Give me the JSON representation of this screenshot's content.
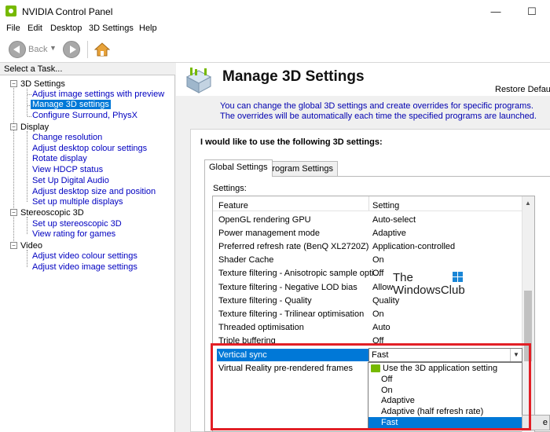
{
  "window": {
    "title": "NVIDIA Control Panel",
    "minimize": "—",
    "maximize": "☐",
    "close": "✕"
  },
  "menu": [
    "File",
    "Edit",
    "Desktop",
    "3D Settings",
    "Help"
  ],
  "toolbar": {
    "back": "Back",
    "back_arrow": "▼"
  },
  "left_panel": {
    "header": "Select a Task...",
    "tree": [
      {
        "category": "3D Settings",
        "items": [
          "Adjust image settings with preview",
          "Manage 3D settings",
          "Configure Surround, PhysX"
        ]
      },
      {
        "category": "Display",
        "items": [
          "Change resolution",
          "Adjust desktop colour settings",
          "Rotate display",
          "View HDCP status",
          "Set Up Digital Audio",
          "Adjust desktop size and position",
          "Set up multiple displays"
        ]
      },
      {
        "category": "Stereoscopic 3D",
        "items": [
          "Set up stereoscopic 3D",
          "View rating for games"
        ]
      },
      {
        "category": "Video",
        "items": [
          "Adjust video colour settings",
          "Adjust video image settings"
        ]
      }
    ],
    "selected": "Manage 3D settings"
  },
  "main": {
    "title": "Manage 3D Settings",
    "restore": "Restore Defaul",
    "description": "You can change the global 3D settings and create overrides for specific programs. The overrides will be automatically each time the specified programs are launched.",
    "heading": "I would like to use the following 3D settings:",
    "tabs": [
      "Global Settings",
      "Program Settings"
    ],
    "settings_label": "Settings:",
    "columns": [
      "Feature",
      "Setting"
    ],
    "rows": [
      {
        "feature": "OpenGL rendering GPU",
        "setting": "Auto-select"
      },
      {
        "feature": "Power management mode",
        "setting": "Adaptive"
      },
      {
        "feature": "Preferred refresh rate (BenQ XL2720Z)",
        "setting": "Application-controlled"
      },
      {
        "feature": "Shader Cache",
        "setting": "On"
      },
      {
        "feature": "Texture filtering - Anisotropic sample opti...",
        "setting": "Off"
      },
      {
        "feature": "Texture filtering - Negative LOD bias",
        "setting": "Allow"
      },
      {
        "feature": "Texture filtering - Quality",
        "setting": "Quality"
      },
      {
        "feature": "Texture filtering - Trilinear optimisation",
        "setting": "On"
      },
      {
        "feature": "Threaded optimisation",
        "setting": "Auto"
      },
      {
        "feature": "Triple buffering",
        "setting": "Off"
      }
    ],
    "selected_row": {
      "feature": "Vertical sync",
      "setting": "Fast"
    },
    "next_row": {
      "feature": "Virtual Reality pre-rendered frames"
    },
    "dropdown_options": [
      "Use the 3D application setting",
      "Off",
      "On",
      "Adaptive",
      "Adaptive (half refresh rate)",
      "Fast"
    ],
    "apply_fragment": "e"
  },
  "watermark": {
    "line1": "The",
    "line2": "WindowsClub"
  },
  "colors": {
    "selection": "#0078d7",
    "highlight_border": "#e21f26",
    "nvidia_green": "#76b900",
    "link": "#0000c0"
  }
}
